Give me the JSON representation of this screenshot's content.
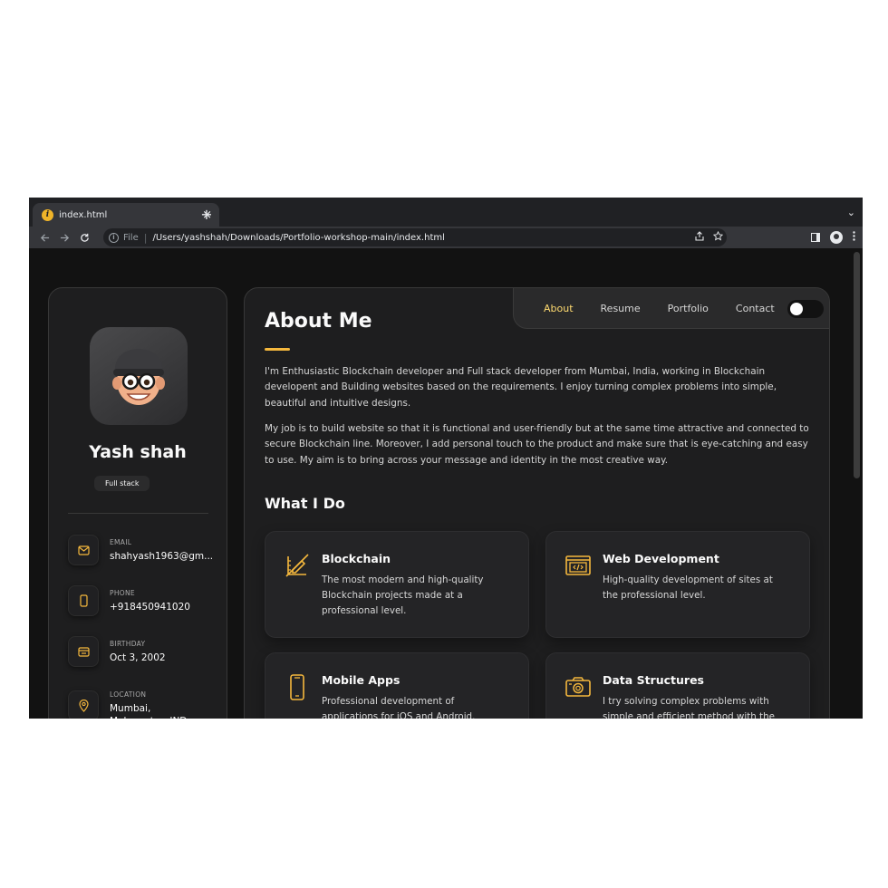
{
  "browser": {
    "tab_title": "index.html",
    "tab_close": "×",
    "new_tab": "+",
    "tab_menu": "⌄",
    "scheme": "File",
    "separator": "|",
    "url": "/Users/yashshah/Downloads/Portfolio-workshop-main/index.html"
  },
  "sidebar": {
    "name": "Yash shah",
    "title": "Full stack",
    "contacts": [
      {
        "label": "Email",
        "value": "shahyash1963@gm...",
        "icon": "mail-icon"
      },
      {
        "label": "Phone",
        "value": "+918450941020",
        "icon": "phone-icon"
      },
      {
        "label": "Birthday",
        "value": "Oct 3, 2002",
        "icon": "calendar-icon"
      },
      {
        "label": "Location",
        "value": "Mumbai, Maharastra, IND",
        "icon": "location-icon"
      }
    ]
  },
  "nav": {
    "links": [
      "About",
      "Resume",
      "Portfolio",
      "Contact"
    ],
    "active": "About"
  },
  "about": {
    "title": "About Me",
    "paragraphs": [
      "I'm Enthusiastic Blockchain developer and Full stack developer from Mumbai, India, working in Blockchain developent and Building websites based on the requirements. I enjoy turning complex problems into simple, beautiful and intuitive designs.",
      "My job is to build website so that it is functional and user-friendly but at the same time attractive and connected to secure Blockchain line. Moreover, I add personal touch to the product and make sure that is eye-catching and easy to use. My aim is to bring across your message and identity in the most creative way."
    ]
  },
  "services": {
    "title": "What I Do",
    "items": [
      {
        "title": "Blockchain",
        "text": "The most modern and high-quality Blockchain projects made at a professional level.",
        "icon": "design-icon"
      },
      {
        "title": "Web Development",
        "text": "High-quality development of sites at the professional level.",
        "icon": "code-icon"
      },
      {
        "title": "Mobile Apps",
        "text": "Professional development of applications for iOS and Android.",
        "icon": "mobile-icon"
      },
      {
        "title": "Data Structures",
        "text": "I try solving complex problems with simple and efficient method with the",
        "icon": "camera-icon"
      }
    ]
  },
  "colors": {
    "accent": "#ffdb70",
    "accent_icon": "#f5b83d",
    "background": "#121212",
    "card": "#1e1e1f"
  }
}
